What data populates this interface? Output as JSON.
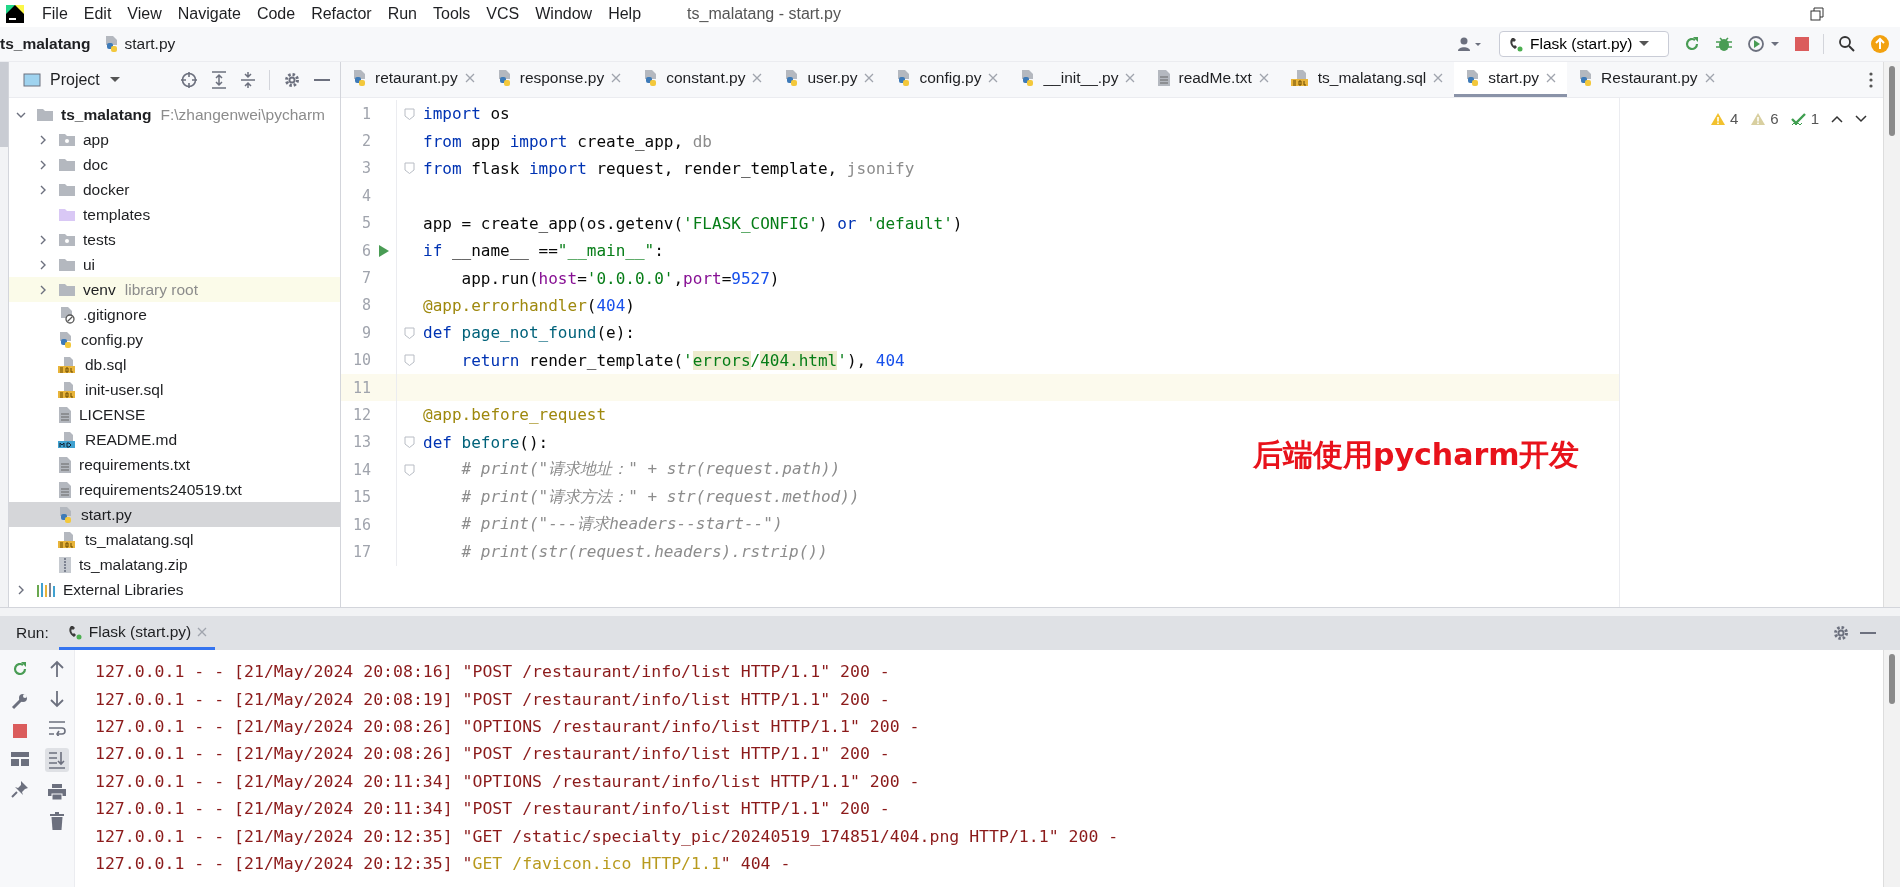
{
  "menu": {
    "items": [
      "File",
      "Edit",
      "View",
      "Navigate",
      "Code",
      "Refactor",
      "Run",
      "Tools",
      "VCS",
      "Window",
      "Help"
    ],
    "title": "ts_malatang - start.py"
  },
  "navbar": {
    "breadcrumb": [
      {
        "text": "ts_malatang",
        "kind": "project"
      },
      {
        "text": "start.py",
        "kind": "python"
      }
    ],
    "run_config": "Flask (start.py)"
  },
  "project_panel": {
    "title": "Project",
    "tree": [
      {
        "name": "ts_malatang",
        "kind": "folder",
        "hint": "F:\\zhangenwei\\pycharm",
        "expanded": true,
        "selected": false,
        "children": [
          {
            "name": "app",
            "kind": "module",
            "expanded": false,
            "selected": false
          },
          {
            "name": "doc",
            "kind": "folder",
            "expanded": false,
            "selected": false
          },
          {
            "name": "docker",
            "kind": "folder",
            "expanded": false,
            "selected": false
          },
          {
            "name": "templates",
            "kind": "templates",
            "selected": false
          },
          {
            "name": "tests",
            "kind": "module",
            "expanded": false,
            "selected": false
          },
          {
            "name": "ui",
            "kind": "folder",
            "expanded": false,
            "selected": false
          },
          {
            "name": "venv",
            "kind": "folder",
            "hint": "library root",
            "expanded": false,
            "selected": false
          },
          {
            "name": ".gitignore",
            "kind": "ignore",
            "selected": false
          },
          {
            "name": "config.py",
            "kind": "python",
            "selected": false
          },
          {
            "name": "db.sql",
            "kind": "sql",
            "selected": false
          },
          {
            "name": "init-user.sql",
            "kind": "sql",
            "selected": false
          },
          {
            "name": "LICENSE",
            "kind": "text",
            "selected": false
          },
          {
            "name": "README.md",
            "kind": "md",
            "selected": false
          },
          {
            "name": "requirements.txt",
            "kind": "text",
            "selected": false
          },
          {
            "name": "requirements240519.txt",
            "kind": "text",
            "selected": false
          },
          {
            "name": "start.py",
            "kind": "python",
            "selected": true
          },
          {
            "name": "ts_malatang.sql",
            "kind": "sql",
            "selected": false
          },
          {
            "name": "ts_malatang.zip",
            "kind": "zip",
            "selected": false
          }
        ]
      },
      {
        "name": "External Libraries",
        "kind": "libraries",
        "expanded": false,
        "selected": false
      }
    ]
  },
  "editor_tabs": [
    {
      "label": "retaurant.py",
      "kind": "python",
      "selected": false
    },
    {
      "label": "response.py",
      "kind": "python",
      "selected": false
    },
    {
      "label": "constant.py",
      "kind": "python",
      "selected": false
    },
    {
      "label": "user.py",
      "kind": "python",
      "selected": false
    },
    {
      "label": "config.py",
      "kind": "python",
      "selected": false
    },
    {
      "label": "__init__.py",
      "kind": "python",
      "selected": false
    },
    {
      "label": "readMe.txt",
      "kind": "text",
      "selected": false
    },
    {
      "label": "ts_malatang.sql",
      "kind": "sql",
      "selected": false
    },
    {
      "label": "start.py",
      "kind": "python",
      "selected": true
    },
    {
      "label": "Restaurant.py",
      "kind": "python",
      "selected": false
    }
  ],
  "inspections": [
    {
      "kind": "warning",
      "count": "4"
    },
    {
      "kind": "weak",
      "count": "6"
    },
    {
      "kind": "typo",
      "count": "1"
    }
  ],
  "code": [
    {
      "number": "1",
      "fold": true,
      "run_marker": false,
      "current": false,
      "tokens": [
        {
          "text": "import",
          "kind": "kw"
        },
        {
          "text": " os",
          "kind": "plain"
        }
      ]
    },
    {
      "number": "2",
      "fold": false,
      "run_marker": false,
      "current": false,
      "tokens": [
        {
          "text": "from",
          "kind": "kw"
        },
        {
          "text": " app ",
          "kind": "plain"
        },
        {
          "text": "import",
          "kind": "kw"
        },
        {
          "text": " create_app, ",
          "kind": "plain"
        },
        {
          "text": "db",
          "kind": "unused"
        }
      ]
    },
    {
      "number": "3",
      "fold": true,
      "run_marker": false,
      "current": false,
      "tokens": [
        {
          "text": "from",
          "kind": "kw"
        },
        {
          "text": " flask ",
          "kind": "plain"
        },
        {
          "text": "import",
          "kind": "kw"
        },
        {
          "text": " request, render_template, ",
          "kind": "plain"
        },
        {
          "text": "jsonify",
          "kind": "unused"
        }
      ]
    },
    {
      "number": "4",
      "fold": false,
      "run_marker": false,
      "current": false
    },
    {
      "number": "5",
      "fold": false,
      "run_marker": false,
      "current": false,
      "tokens": [
        {
          "text": "app = create_app(os.getenv(",
          "kind": "plain"
        },
        {
          "text": "'FLASK_CONFIG'",
          "kind": "str"
        },
        {
          "text": ") ",
          "kind": "plain"
        },
        {
          "text": "or",
          "kind": "kw"
        },
        {
          "text": " 'default'",
          "kind": "str"
        },
        {
          "text": ")",
          "kind": "plain"
        }
      ]
    },
    {
      "number": "6",
      "fold": false,
      "run_marker": true,
      "current": false,
      "tokens": [
        {
          "text": "if",
          "kind": "kw"
        },
        {
          "text": " __name__ ==",
          "kind": "plain"
        },
        {
          "text": "\"__main__\"",
          "kind": "str"
        },
        {
          "text": ":",
          "kind": "plain"
        }
      ]
    },
    {
      "number": "7",
      "fold": false,
      "run_marker": false,
      "current": false,
      "tokens": [
        {
          "text": "    app.run(",
          "kind": "plain"
        },
        {
          "text": "host",
          "kind": "param"
        },
        {
          "text": "=",
          "kind": "plain"
        },
        {
          "text": "'0.0.0.0'",
          "kind": "str"
        },
        {
          "text": ",",
          "kind": "plain"
        },
        {
          "text": "port",
          "kind": "param"
        },
        {
          "text": "=",
          "kind": "plain"
        },
        {
          "text": "9527",
          "kind": "num"
        },
        {
          "text": ")",
          "kind": "plain"
        }
      ]
    },
    {
      "number": "8",
      "fold": false,
      "run_marker": false,
      "current": false,
      "tokens": [
        {
          "text": "@app.errorhandler",
          "kind": "deco"
        },
        {
          "text": "(",
          "kind": "plain"
        },
        {
          "text": "404",
          "kind": "num"
        },
        {
          "text": ")",
          "kind": "plain"
        }
      ]
    },
    {
      "number": "9",
      "fold": true,
      "run_marker": false,
      "current": false,
      "tokens": [
        {
          "text": "def",
          "kind": "kw"
        },
        {
          "text": " page_not_found",
          "kind": "fn"
        },
        {
          "text": "(e):",
          "kind": "plain"
        }
      ]
    },
    {
      "number": "10",
      "fold": true,
      "run_marker": false,
      "current": false,
      "tokens": [
        {
          "text": "    return",
          "kind": "kw"
        },
        {
          "text": " render_template(",
          "kind": "plain"
        },
        {
          "text": "'",
          "kind": "str"
        },
        {
          "text": "errors",
          "kind": "match"
        },
        {
          "text": "/",
          "kind": "str"
        },
        {
          "text": "404.html",
          "kind": "match"
        },
        {
          "text": "'",
          "kind": "str"
        },
        {
          "text": "), ",
          "kind": "plain"
        },
        {
          "text": "404",
          "kind": "num"
        }
      ]
    },
    {
      "number": "11",
      "fold": false,
      "run_marker": false,
      "current": true
    },
    {
      "number": "12",
      "fold": false,
      "run_marker": false,
      "current": false,
      "tokens": [
        {
          "text": "@app.before_request",
          "kind": "deco"
        }
      ]
    },
    {
      "number": "13",
      "fold": true,
      "run_marker": false,
      "current": false,
      "tokens": [
        {
          "text": "def",
          "kind": "kw"
        },
        {
          "text": " before",
          "kind": "fn"
        },
        {
          "text": "():",
          "kind": "plain"
        }
      ]
    },
    {
      "number": "14",
      "fold": true,
      "run_marker": false,
      "current": false,
      "tokens": [
        {
          "text": "    # print(\"请求地址：\" + str(request.path))",
          "kind": "comment"
        }
      ]
    },
    {
      "number": "15",
      "fold": false,
      "run_marker": false,
      "current": false,
      "tokens": [
        {
          "text": "    # print(\"请求方法：\" + str(request.method))",
          "kind": "comment"
        }
      ]
    },
    {
      "number": "16",
      "fold": false,
      "run_marker": false,
      "current": false,
      "tokens": [
        {
          "text": "    # print(\"---请求headers--start--\")",
          "kind": "comment"
        }
      ]
    },
    {
      "number": "17",
      "fold": false,
      "run_marker": false,
      "current": false,
      "tokens": [
        {
          "text": "    # print(str(request.headers).rstrip())",
          "kind": "comment"
        }
      ]
    }
  ],
  "annotation": "后端使用pycharm开发",
  "run_panel": {
    "label": "Run:",
    "tabs": [
      {
        "label": "Flask (start.py)",
        "selected": true
      }
    ],
    "log": [
      {
        "segments": [
          {
            "text": "127.0.0.1 - - [21/May/2024 20:08:16] \"POST /restaurant/info/list HTTP/1.1\" 200 -",
            "kind": "normal"
          }
        ]
      },
      {
        "segments": [
          {
            "text": "127.0.0.1 - - [21/May/2024 20:08:19] \"POST /restaurant/info/list HTTP/1.1\" 200 -",
            "kind": "normal"
          }
        ]
      },
      {
        "segments": [
          {
            "text": "127.0.0.1 - - [21/May/2024 20:08:26] \"OPTIONS /restaurant/info/list HTTP/1.1\" 200 -",
            "kind": "normal"
          }
        ]
      },
      {
        "segments": [
          {
            "text": "127.0.0.1 - - [21/May/2024 20:08:26] \"POST /restaurant/info/list HTTP/1.1\" 200 -",
            "kind": "normal"
          }
        ]
      },
      {
        "segments": [
          {
            "text": "127.0.0.1 - - [21/May/2024 20:11:34] \"OPTIONS /restaurant/info/list HTTP/1.1\" 200 -",
            "kind": "normal"
          }
        ]
      },
      {
        "segments": [
          {
            "text": "127.0.0.1 - - [21/May/2024 20:11:34] \"POST /restaurant/info/list HTTP/1.1\" 200 -",
            "kind": "normal"
          }
        ]
      },
      {
        "segments": [
          {
            "text": "127.0.0.1 - - [21/May/2024 20:12:35] \"GET /static/specialty_pic/20240519_174851/404.png HTTP/1.1\" 200 -",
            "kind": "normal"
          }
        ]
      },
      {
        "segments": [
          {
            "text": "127.0.0.1 - - [21/May/2024 20:12:35] \"",
            "kind": "normal"
          },
          {
            "text": "GET /favicon.ico HTTP/1.1",
            "kind": "warn"
          },
          {
            "text": "\" 404 -",
            "kind": "normal"
          }
        ]
      }
    ]
  }
}
